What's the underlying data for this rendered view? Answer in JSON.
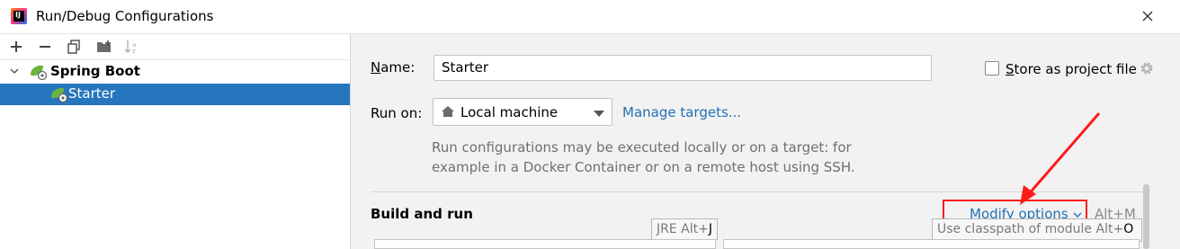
{
  "window": {
    "title": "Run/Debug Configurations"
  },
  "toolbar": {
    "add": "add-icon",
    "remove": "remove-icon",
    "copy": "copy-icon",
    "folder": "new-folder-icon",
    "sort": "sort-icon"
  },
  "tree": {
    "group_label": "Spring Boot",
    "items": [
      {
        "label": "Starter"
      }
    ]
  },
  "form": {
    "name_label": "Name:",
    "name_value": "Starter",
    "store_label": "Store as project file",
    "store_checked": false,
    "run_on_label": "Run on:",
    "run_on_value": "Local machine",
    "manage_targets": "Manage targets...",
    "hint_line1": "Run configurations may be executed locally or on a target: for",
    "hint_line2": "example in a Docker Container or on a remote host using SSH."
  },
  "build_run": {
    "title": "Build and run",
    "modify_options": "Modify options",
    "modify_shortcut": "Alt+M",
    "jre_hint": "JRE",
    "jre_shortcut_prefix": "Alt+",
    "jre_shortcut_key": "J",
    "classpath_hint": "Use classpath of module",
    "classpath_shortcut_prefix": "Alt+",
    "classpath_shortcut_key": "O"
  },
  "colors": {
    "selection": "#2675bf",
    "link": "#2470b3",
    "annotation": "#ff1a1a"
  }
}
